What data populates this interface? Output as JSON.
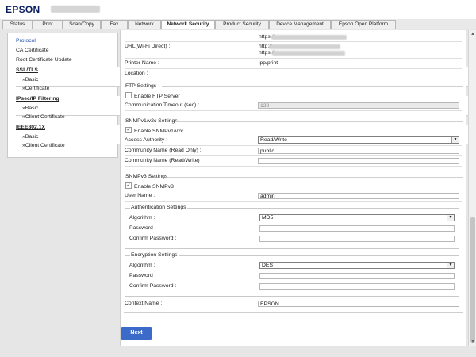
{
  "header": {
    "logo": "EPSON",
    "model": ""
  },
  "tabs": [
    {
      "label": "Status"
    },
    {
      "label": "Print"
    },
    {
      "label": "Scan/Copy"
    },
    {
      "label": "Fax"
    },
    {
      "label": "Network"
    },
    {
      "label": "Network Security",
      "active": true
    },
    {
      "label": "Product Security"
    },
    {
      "label": "Device Management"
    },
    {
      "label": "Epson Open Platform"
    }
  ],
  "sidebar": {
    "items": [
      {
        "label": "Protocol",
        "active": true
      },
      {
        "label": "CA Certificate"
      },
      {
        "label": "Root Certificate Update"
      },
      {
        "label": "SSL/TLS",
        "header": true
      },
      {
        "label": "»Basic"
      },
      {
        "label": "»Certificate"
      },
      {
        "label": "IPsec/IP Filtering",
        "header": true
      },
      {
        "label": "»Basic"
      },
      {
        "label": "»Client Certificate"
      },
      {
        "label": "IEEE802.1X",
        "header": true
      },
      {
        "label": "»Basic"
      },
      {
        "label": "»Client Certificate"
      }
    ]
  },
  "main": {
    "top": {
      "url_prefix": "https://",
      "wifi_label": "URL(Wi-Fi Direct) :",
      "wifi_http": "http://",
      "wifi_https": "https://",
      "printer_name_label": "Printer Name :",
      "printer_name_value": "ipp/print",
      "location_label": "Location :"
    },
    "ftp": {
      "title": "FTP Settings",
      "enable_label": "Enable FTP Server",
      "enabled": false,
      "timeout_label": "Communication Timeout (sec) :",
      "timeout_value": "120"
    },
    "snmpv1": {
      "title": "SNMPv1/v2c Settings",
      "enable_label": "Enable SNMPv1/v2c",
      "enabled": true,
      "access_label": "Access Authority :",
      "access_value": "Read/Write",
      "ro_label": "Community Name (Read Only) :",
      "ro_value": "public",
      "rw_label": "Community Name (Read/Write) :",
      "rw_value": ""
    },
    "snmpv3": {
      "title": "SNMPv3 Settings",
      "enable_label": "Enable SNMPv3",
      "enabled": true,
      "user_label": "User Name :",
      "user_value": "admin",
      "auth": {
        "title": "Authentication Settings",
        "algorithm_label": "Algorithm :",
        "algorithm_value": "MD5",
        "password_label": "Password :",
        "confirm_label": "Confirm Password :"
      },
      "enc": {
        "title": "Encryption Settings",
        "algorithm_label": "Algorithm :",
        "algorithm_value": "DES",
        "password_label": "Password :",
        "confirm_label": "Confirm Password :"
      },
      "context_label": "Context Name :",
      "context_value": "EPSON"
    },
    "next_label": "Next"
  },
  "colors": {
    "accent": "#3b6ac9",
    "link": "#1f4fb5",
    "brand": "#0b1d5e"
  }
}
